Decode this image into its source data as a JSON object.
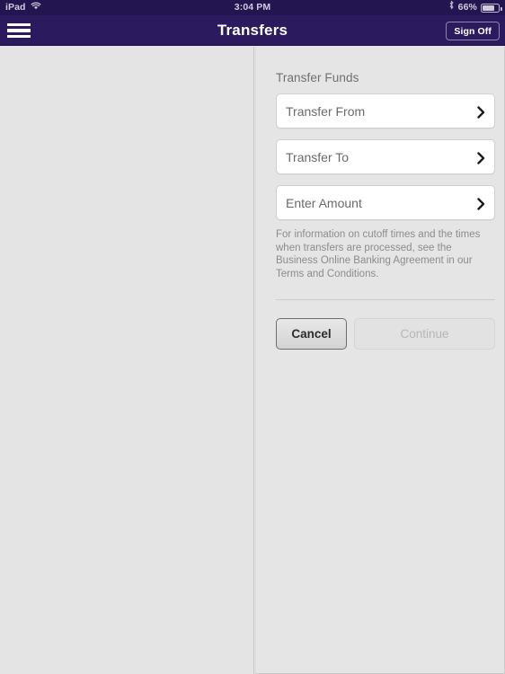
{
  "status_bar": {
    "device_label": "iPad",
    "wifi_icon": "wifi-icon",
    "time": "3:04 PM",
    "bluetooth_icon": "bluetooth-icon",
    "battery_percent": "66%",
    "battery_icon": "battery-icon"
  },
  "nav_bar": {
    "menu_icon": "hamburger-menu-icon",
    "title": "Transfers",
    "sign_off_label": "Sign Off",
    "background_color": "#2b1b5e"
  },
  "form": {
    "section_title": "Transfer Funds",
    "fields": [
      {
        "label": "Transfer From",
        "chevron_icon": "chevron-right-icon"
      },
      {
        "label": "Transfer To",
        "chevron_icon": "chevron-right-icon"
      },
      {
        "label": "Enter Amount",
        "chevron_icon": "chevron-right-icon"
      }
    ],
    "info_text": "For information on cutoff times and the times when transfers are processed, see the Business Online Banking Agreement in our Terms and Conditions.",
    "buttons": {
      "cancel_label": "Cancel",
      "continue_label": "Continue"
    }
  }
}
